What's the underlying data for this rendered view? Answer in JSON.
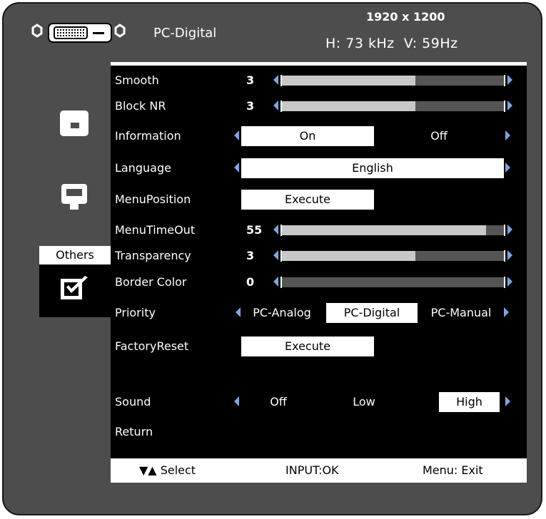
{
  "header": {
    "source": "PC-Digital",
    "resolution": "1920 x 1200",
    "frequency": "H: 73 kHz  V: 59Hz"
  },
  "sidebar": {
    "active_label": "Others",
    "items": [
      {
        "icon": "monitor-small-icon"
      },
      {
        "icon": "monitor-icon"
      },
      {
        "icon": "checkbox-icon"
      }
    ]
  },
  "menu": {
    "smooth": {
      "label": "Smooth",
      "value": "3",
      "level": 0.6
    },
    "block_nr": {
      "label": "Block NR",
      "value": "3",
      "level": 0.6
    },
    "information": {
      "label": "Information",
      "options": [
        "On",
        "Off"
      ],
      "selected": "On"
    },
    "language": {
      "label": "Language",
      "value": "English"
    },
    "menu_position": {
      "label": "MenuPosition",
      "button": "Execute"
    },
    "menu_timeout": {
      "label": "MenuTimeOut",
      "value": "55",
      "level": 0.92
    },
    "transparency": {
      "label": "Transparency",
      "value": "3",
      "level": 0.6
    },
    "border_color": {
      "label": "Border Color",
      "value": "0",
      "level": 0.0
    },
    "priority": {
      "label": "Priority",
      "options": [
        "PC-Analog",
        "PC-Digital",
        "PC-Manual"
      ],
      "selected": "PC-Digital"
    },
    "factory_reset": {
      "label": "FactoryReset",
      "button": "Execute"
    },
    "sound": {
      "label": "Sound",
      "options": [
        "Off",
        "Low",
        "High"
      ],
      "selected": "High"
    },
    "return": {
      "label": "Return"
    }
  },
  "footer": {
    "select": "▼▲ Select",
    "ok": "INPUT:OK",
    "exit": "Menu: Exit"
  },
  "colors": {
    "frame": "#4d4d4d",
    "panel": "#000000",
    "arrow": "#7ea6e0",
    "slider_fill": "#c8c8c8",
    "slider_track": "#555555"
  }
}
